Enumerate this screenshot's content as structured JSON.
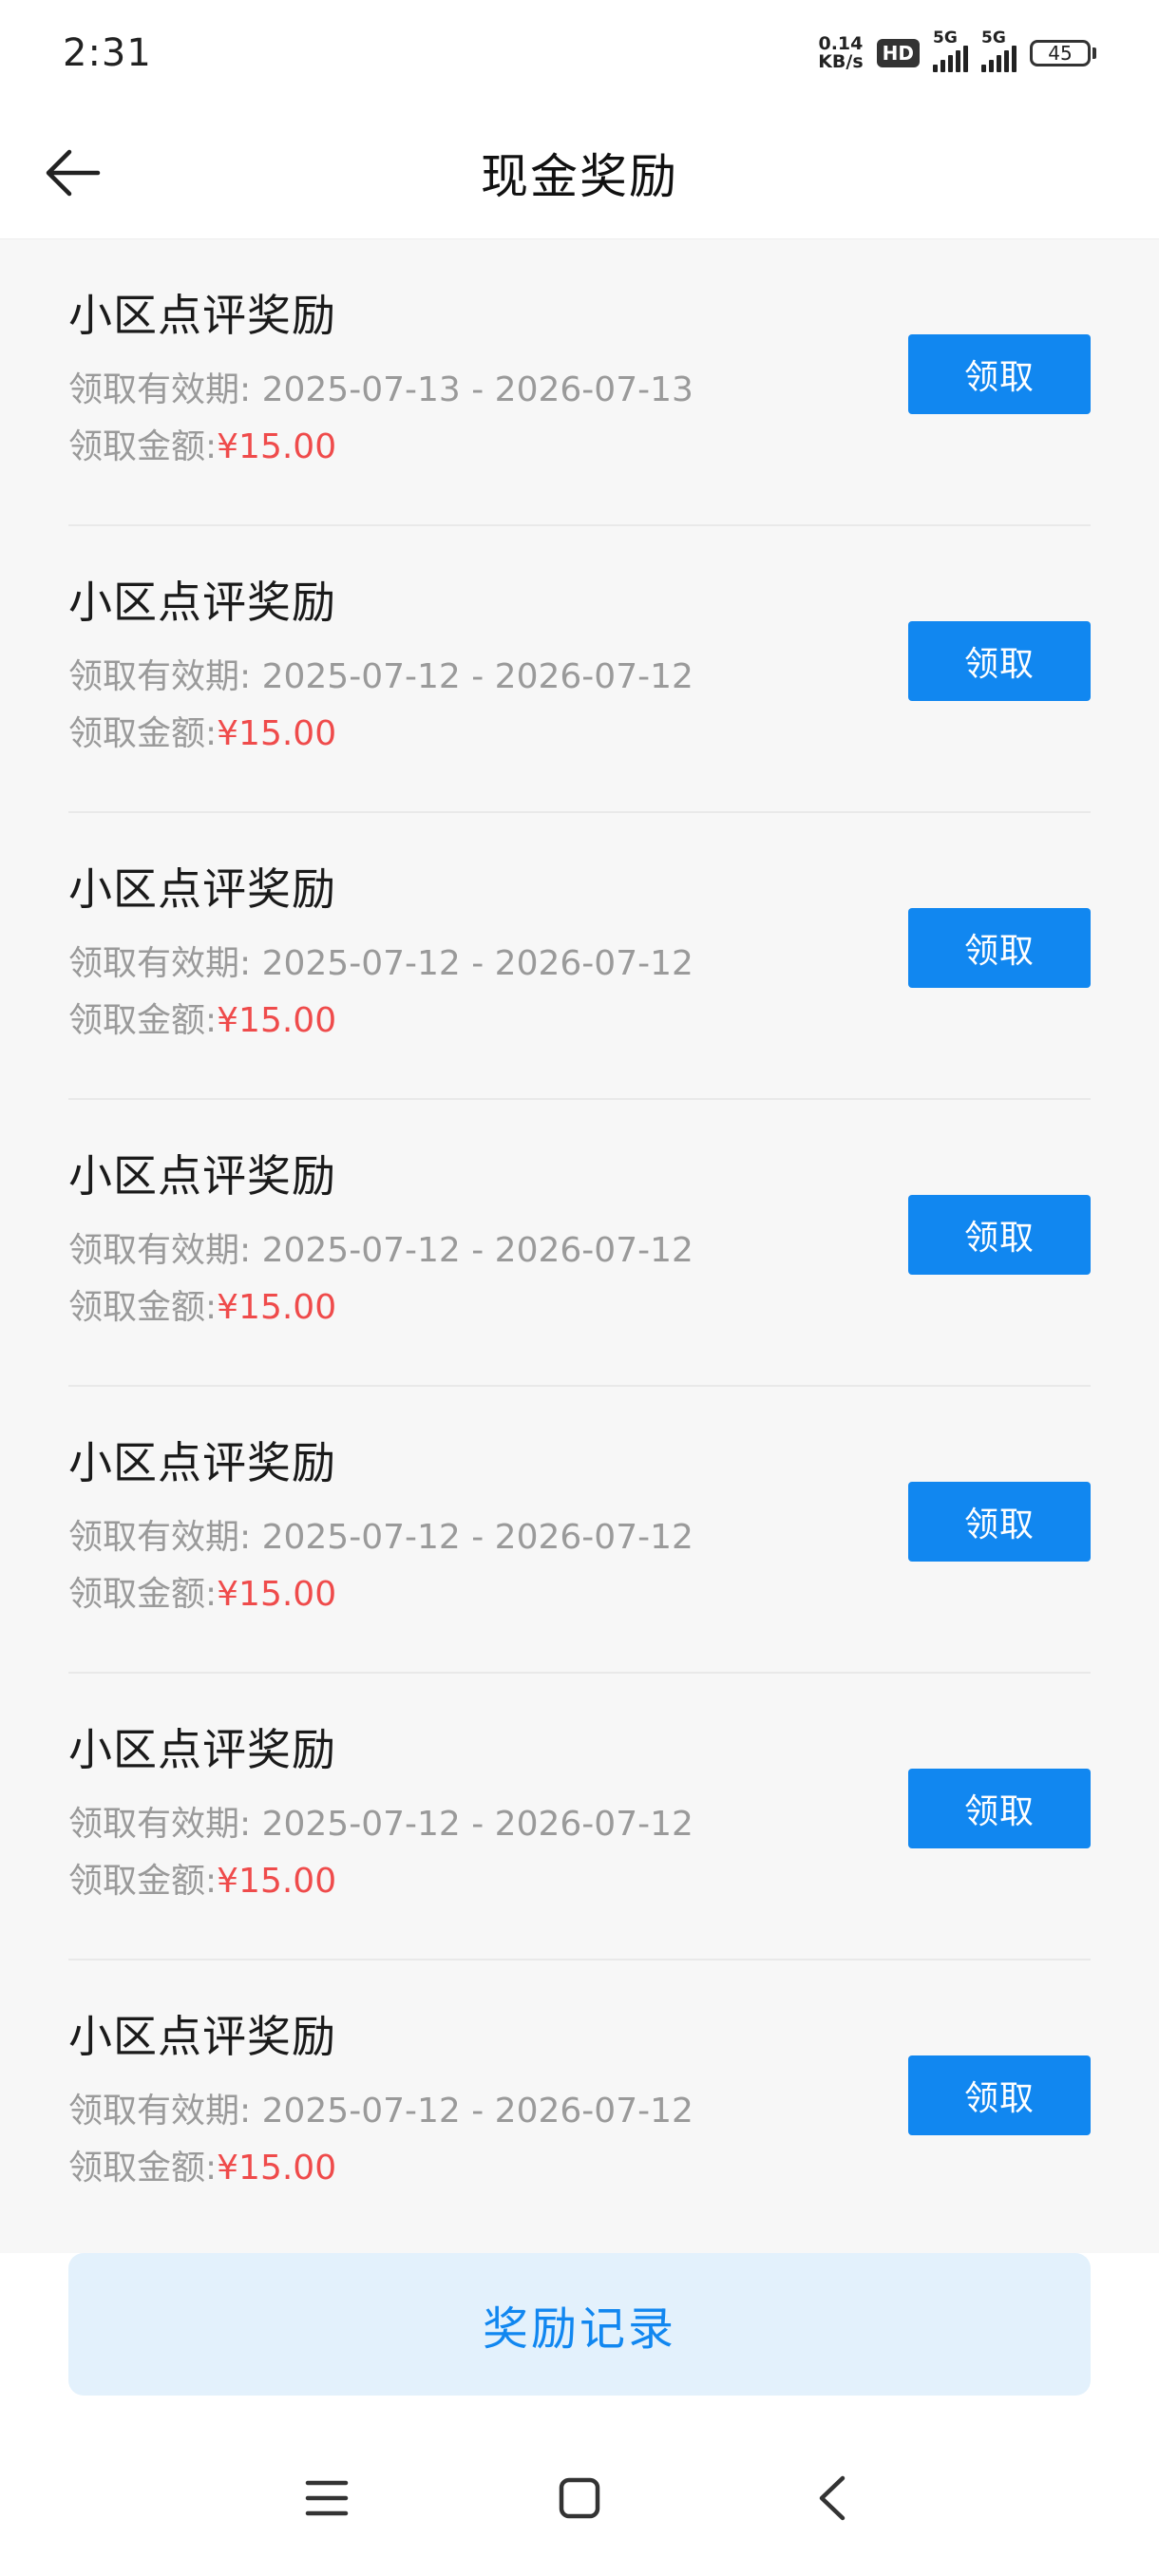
{
  "status_bar": {
    "time": "2:31",
    "net_speed_value": "0.14",
    "net_speed_unit": "KB/s",
    "hd_badge": "HD",
    "signal_1_gen": "5G",
    "signal_2_gen": "5G",
    "battery_level": "45"
  },
  "header": {
    "title": "现金奖励",
    "back_icon": "arrow-left-icon"
  },
  "rewards": [
    {
      "title": "小区点评奖励",
      "validity_label": "领取有效期:",
      "validity_range": "2025-07-13 - 2026-07-13",
      "amount_label": "领取金额:",
      "amount_value": "¥15.00",
      "claim_label": "领取"
    },
    {
      "title": "小区点评奖励",
      "validity_label": "领取有效期:",
      "validity_range": "2025-07-12 - 2026-07-12",
      "amount_label": "领取金额:",
      "amount_value": "¥15.00",
      "claim_label": "领取"
    },
    {
      "title": "小区点评奖励",
      "validity_label": "领取有效期:",
      "validity_range": "2025-07-12 - 2026-07-12",
      "amount_label": "领取金额:",
      "amount_value": "¥15.00",
      "claim_label": "领取"
    },
    {
      "title": "小区点评奖励",
      "validity_label": "领取有效期:",
      "validity_range": "2025-07-12 - 2026-07-12",
      "amount_label": "领取金额:",
      "amount_value": "¥15.00",
      "claim_label": "领取"
    },
    {
      "title": "小区点评奖励",
      "validity_label": "领取有效期:",
      "validity_range": "2025-07-12 - 2026-07-12",
      "amount_label": "领取金额:",
      "amount_value": "¥15.00",
      "claim_label": "领取"
    },
    {
      "title": "小区点评奖励",
      "validity_label": "领取有效期:",
      "validity_range": "2025-07-12 - 2026-07-12",
      "amount_label": "领取金额:",
      "amount_value": "¥15.00",
      "claim_label": "领取"
    },
    {
      "title": "小区点评奖励",
      "validity_label": "领取有效期:",
      "validity_range": "2025-07-12 - 2026-07-12",
      "amount_label": "领取金额:",
      "amount_value": "¥15.00",
      "claim_label": "领取"
    }
  ],
  "footer": {
    "records_label": "奖励记录"
  },
  "system_nav": {
    "menu_icon": "menu-icon",
    "home_icon": "home-square-icon",
    "back_icon": "chevron-left-icon"
  },
  "colors": {
    "primary_blue": "#1187f0",
    "amount_red": "#ef4b4b",
    "muted_gray": "#9a9a9a",
    "list_background": "#f7f7f7",
    "records_background": "#e3f1fc"
  }
}
